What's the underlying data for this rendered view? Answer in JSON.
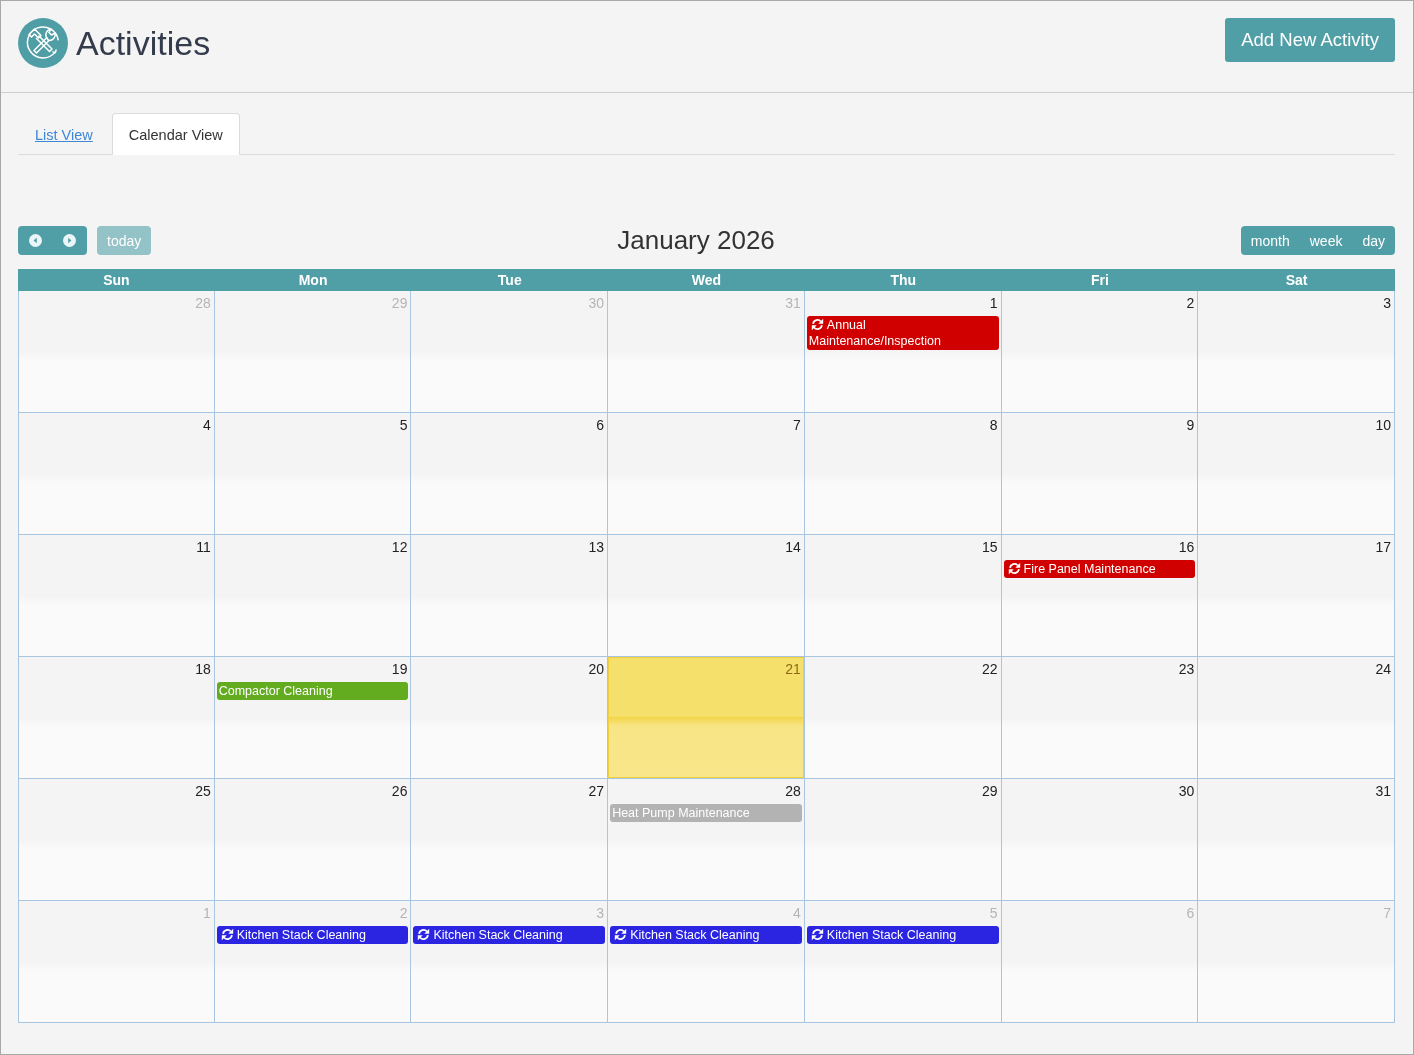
{
  "header": {
    "title": "Activities",
    "add_button": "Add New Activity"
  },
  "tabs": [
    {
      "label": "List View",
      "selected": false
    },
    {
      "label": "Calendar View",
      "selected": true
    }
  ],
  "calendar": {
    "today_button": {
      "label": "today",
      "disabled": true
    },
    "title": "January 2026",
    "views": [
      "month",
      "week",
      "day"
    ],
    "weekdays": [
      "Sun",
      "Mon",
      "Tue",
      "Wed",
      "Thu",
      "Fri",
      "Sat"
    ],
    "weeks": [
      {
        "days": [
          {
            "day": "28",
            "other_month": true,
            "today": false
          },
          {
            "day": "29",
            "other_month": true,
            "today": false
          },
          {
            "day": "30",
            "other_month": true,
            "today": false
          },
          {
            "day": "31",
            "other_month": true,
            "today": false
          },
          {
            "day": "1",
            "other_month": false,
            "today": false,
            "events": [
              {
                "title": "Annual Maintenance/Inspection",
                "color": "#d10000",
                "recurring": true
              }
            ]
          },
          {
            "day": "2",
            "other_month": false,
            "today": false
          },
          {
            "day": "3",
            "other_month": false,
            "today": false
          }
        ]
      },
      {
        "days": [
          {
            "day": "4",
            "other_month": false,
            "today": false
          },
          {
            "day": "5",
            "other_month": false,
            "today": false
          },
          {
            "day": "6",
            "other_month": false,
            "today": false
          },
          {
            "day": "7",
            "other_month": false,
            "today": false
          },
          {
            "day": "8",
            "other_month": false,
            "today": false
          },
          {
            "day": "9",
            "other_month": false,
            "today": false
          },
          {
            "day": "10",
            "other_month": false,
            "today": false
          }
        ]
      },
      {
        "days": [
          {
            "day": "11",
            "other_month": false,
            "today": false
          },
          {
            "day": "12",
            "other_month": false,
            "today": false
          },
          {
            "day": "13",
            "other_month": false,
            "today": false
          },
          {
            "day": "14",
            "other_month": false,
            "today": false
          },
          {
            "day": "15",
            "other_month": false,
            "today": false
          },
          {
            "day": "16",
            "other_month": false,
            "today": false,
            "events": [
              {
                "title": "Fire Panel Maintenance",
                "color": "#d10000",
                "recurring": true
              }
            ]
          },
          {
            "day": "17",
            "other_month": false,
            "today": false
          }
        ]
      },
      {
        "days": [
          {
            "day": "18",
            "other_month": false,
            "today": false
          },
          {
            "day": "19",
            "other_month": false,
            "today": false,
            "events": [
              {
                "title": "Compactor Cleaning",
                "color": "#63ab1f",
                "recurring": false
              }
            ]
          },
          {
            "day": "20",
            "other_month": false,
            "today": false
          },
          {
            "day": "21",
            "other_month": false,
            "today": true
          },
          {
            "day": "22",
            "other_month": false,
            "today": false
          },
          {
            "day": "23",
            "other_month": false,
            "today": false
          },
          {
            "day": "24",
            "other_month": false,
            "today": false
          }
        ]
      },
      {
        "days": [
          {
            "day": "25",
            "other_month": false,
            "today": false
          },
          {
            "day": "26",
            "other_month": false,
            "today": false
          },
          {
            "day": "27",
            "other_month": false,
            "today": false
          },
          {
            "day": "28",
            "other_month": false,
            "today": false,
            "events": [
              {
                "title": "Heat Pump Maintenance",
                "color": "#b3b3b3",
                "recurring": false
              }
            ]
          },
          {
            "day": "29",
            "other_month": false,
            "today": false
          },
          {
            "day": "30",
            "other_month": false,
            "today": false
          },
          {
            "day": "31",
            "other_month": false,
            "today": false
          }
        ]
      },
      {
        "days": [
          {
            "day": "1",
            "other_month": true,
            "today": false
          },
          {
            "day": "2",
            "other_month": true,
            "today": false,
            "events": [
              {
                "title": "Kitchen Stack Cleaning",
                "color": "#2b25e2",
                "recurring": true
              }
            ]
          },
          {
            "day": "3",
            "other_month": true,
            "today": false,
            "events": [
              {
                "title": "Kitchen Stack Cleaning",
                "color": "#2b25e2",
                "recurring": true
              }
            ]
          },
          {
            "day": "4",
            "other_month": true,
            "today": false,
            "events": [
              {
                "title": "Kitchen Stack Cleaning",
                "color": "#2b25e2",
                "recurring": true
              }
            ]
          },
          {
            "day": "5",
            "other_month": true,
            "today": false,
            "events": [
              {
                "title": "Kitchen Stack Cleaning",
                "color": "#2b25e2",
                "recurring": true
              }
            ]
          },
          {
            "day": "6",
            "other_month": true,
            "today": false
          },
          {
            "day": "7",
            "other_month": true,
            "today": false
          }
        ]
      }
    ]
  }
}
